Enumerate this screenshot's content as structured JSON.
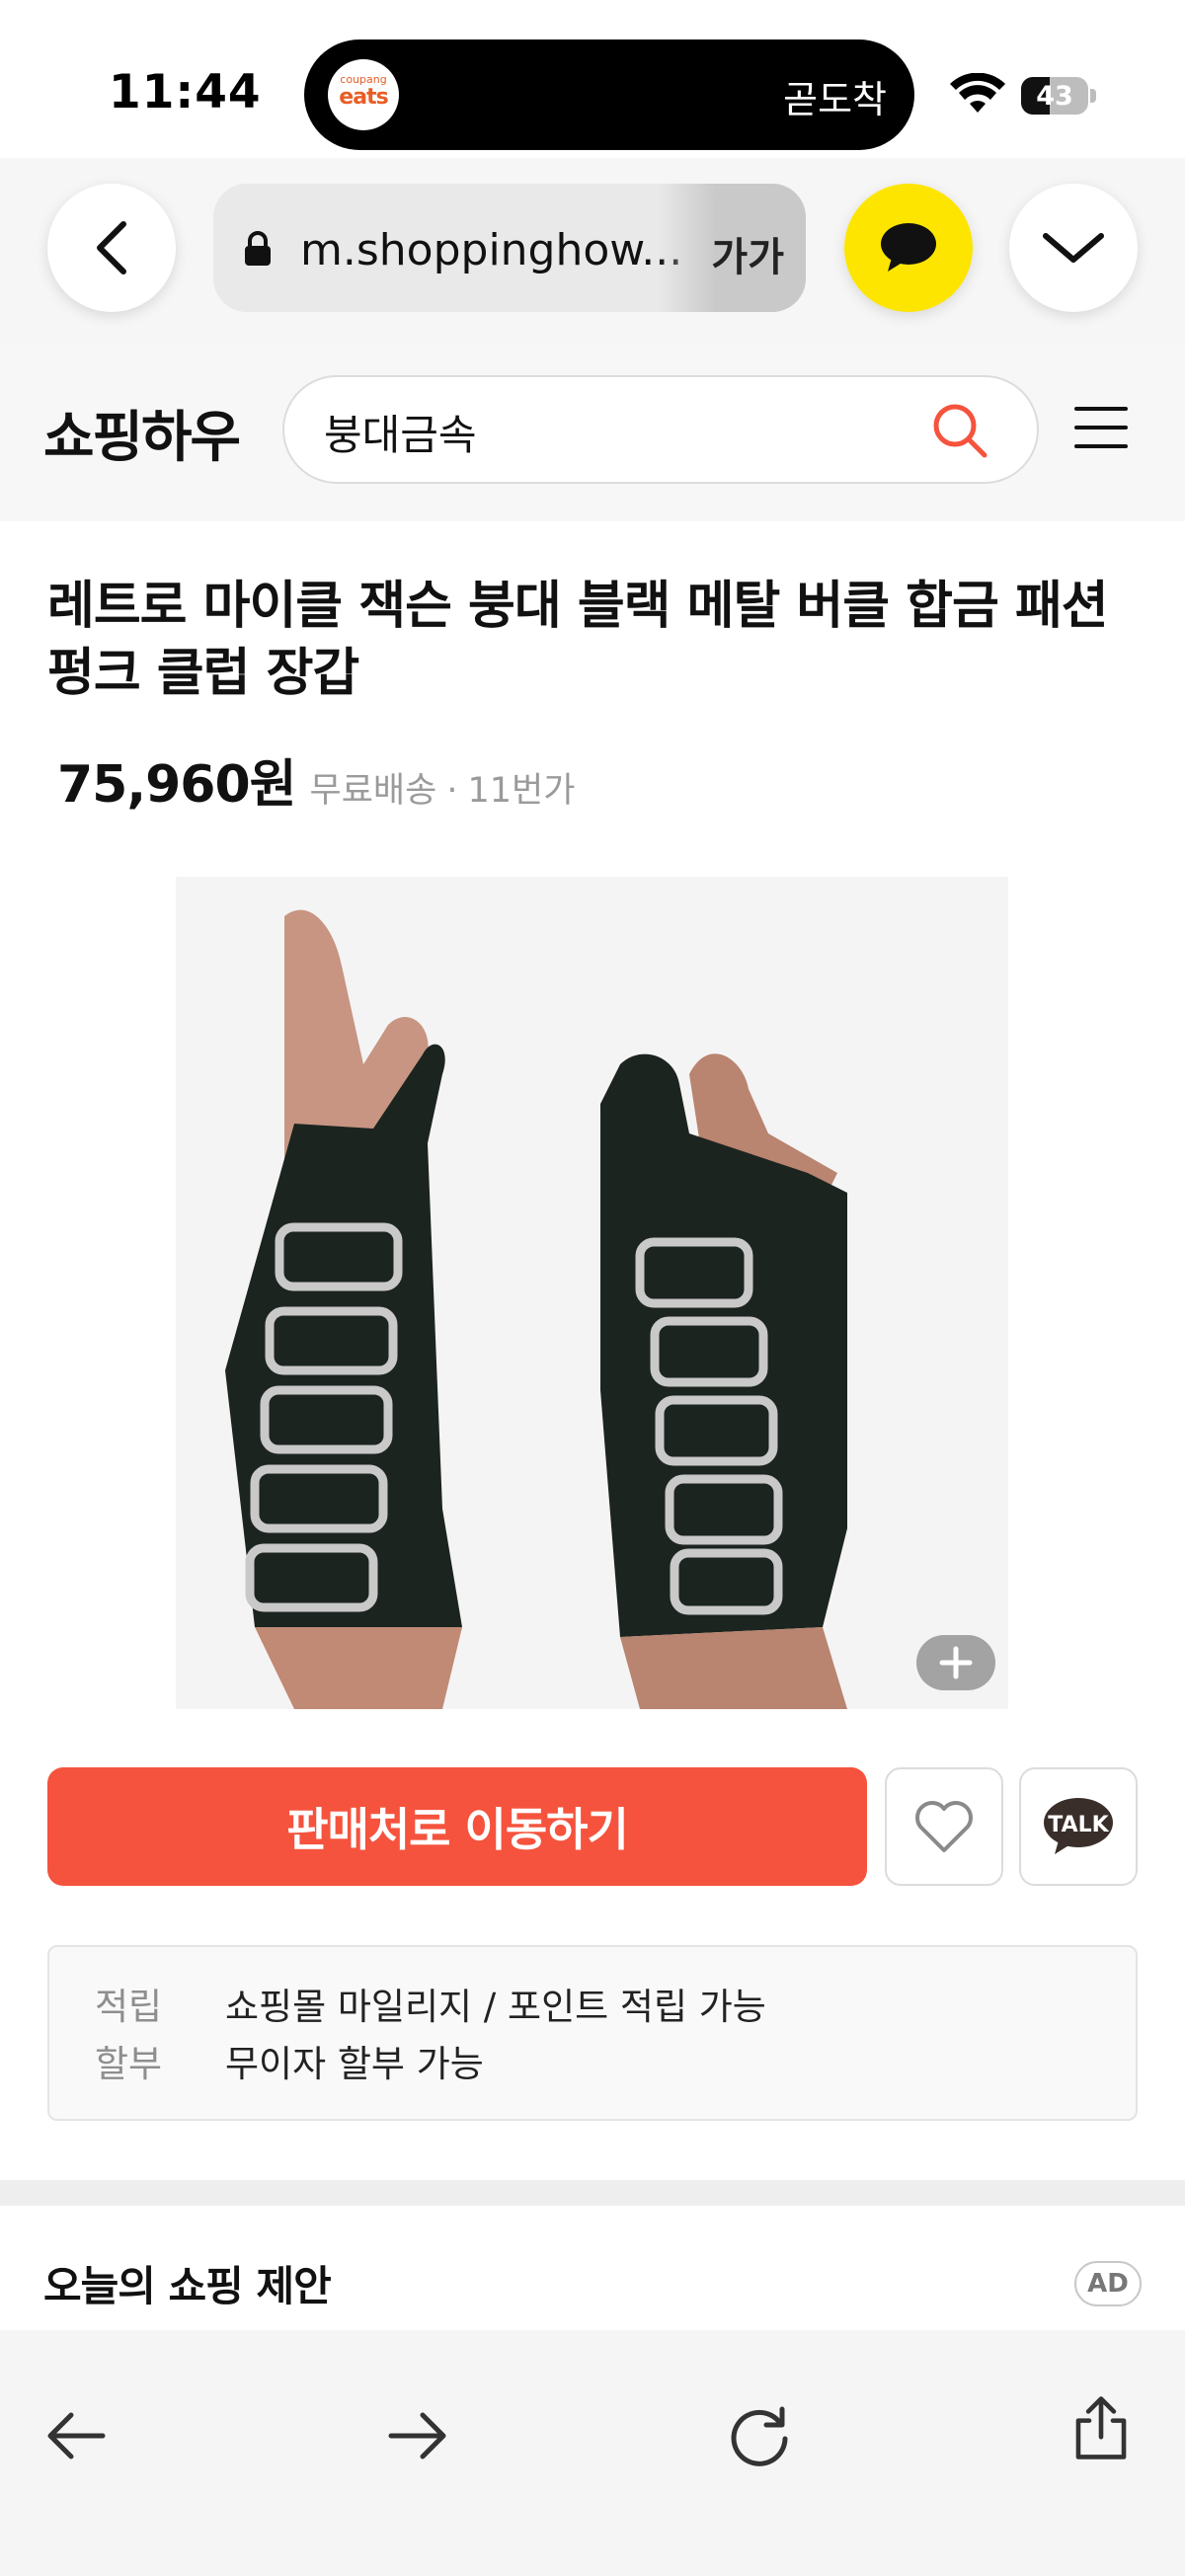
{
  "status_bar": {
    "time": "11:44",
    "island_app_small": "coupang",
    "island_app_name": "eats",
    "island_text": "곧도착",
    "battery_level": "43",
    "battery_fraction": 0.43
  },
  "browser": {
    "url": "m.shoppinghow...",
    "text_size_label": "가가",
    "icons": [
      "chevron-left-icon",
      "lock-icon",
      "kakao-chat-icon",
      "chevron-down-icon"
    ]
  },
  "site": {
    "logo": "쇼핑하우",
    "search_value": "붕대금속"
  },
  "product": {
    "title": "레트로 마이클 잭슨 붕대 블랙 메탈 버클 합금 패션 펑크 클럽 장갑",
    "price": "75,960원",
    "shipping": "무료배송",
    "seller": "11번가",
    "buy_button": "판매처로 이동하기",
    "talk_label": "TALK",
    "benefits": [
      {
        "label": "적립",
        "value": "쇼핑몰 마일리지 / 포인트 적립 가능"
      },
      {
        "label": "할부",
        "value": "무이자 할부 가능"
      }
    ]
  },
  "recommendations": {
    "title": "오늘의 쇼핑 제안",
    "ad_label": "AD"
  },
  "colors": {
    "accent": "#f5533d",
    "kakao_yellow": "#fee500",
    "search_icon": "#f5533d"
  }
}
